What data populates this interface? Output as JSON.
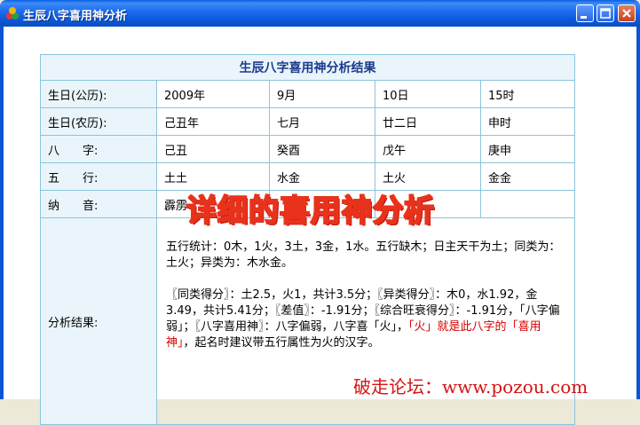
{
  "window": {
    "title": "生辰八字喜用神分析"
  },
  "result": {
    "heading": "生辰八字喜用神分析结果",
    "rows": [
      {
        "label": "生日(公历):",
        "values": [
          "2009年",
          "9月",
          "10日",
          "15时"
        ]
      },
      {
        "label": "生日(农历):",
        "values": [
          "己丑年",
          "七月",
          "廿二日",
          "申时"
        ]
      },
      {
        "label": "八　　字:",
        "values": [
          "己丑",
          "癸酉",
          "戊午",
          "庚申"
        ]
      },
      {
        "label": "五　　行:",
        "values": [
          "土土",
          "水金",
          "土火",
          "金金"
        ]
      },
      {
        "label": "纳　　音:",
        "values": [
          "霹雳",
          "",
          "",
          ""
        ]
      }
    ],
    "analysis_label": "分析结果:",
    "analysis": {
      "p1": "五行统计：0木，1火，3土，3金，1水。五行缺木；日主天干为土；同类为：土火；异类为：木水金。",
      "p2_a": "〖同类得分〗：土2.5，火1，共计3.5分；〖异类得分〗：木0，水1.92，金3.49，共计5.41分；〖差值〗：-1.91分；〖综合旺衰得分〗：-1.91分，「八字偏弱」；〖八字喜用神〗：八字偏弱，八字喜「火」，",
      "p2_red": "「火」就是此八字的「喜用神」",
      "p2_b": "，起名时建议带五行属性为火的汉字。"
    }
  },
  "overlay_text": "详细的喜用神分析",
  "watermark": "破走论坛：www.pozou.com",
  "colors": {
    "titlebar": "#0b58d8",
    "table_border": "#8cc4dc",
    "label_bg": "#e9f5fb",
    "highlight": "#d40000"
  }
}
